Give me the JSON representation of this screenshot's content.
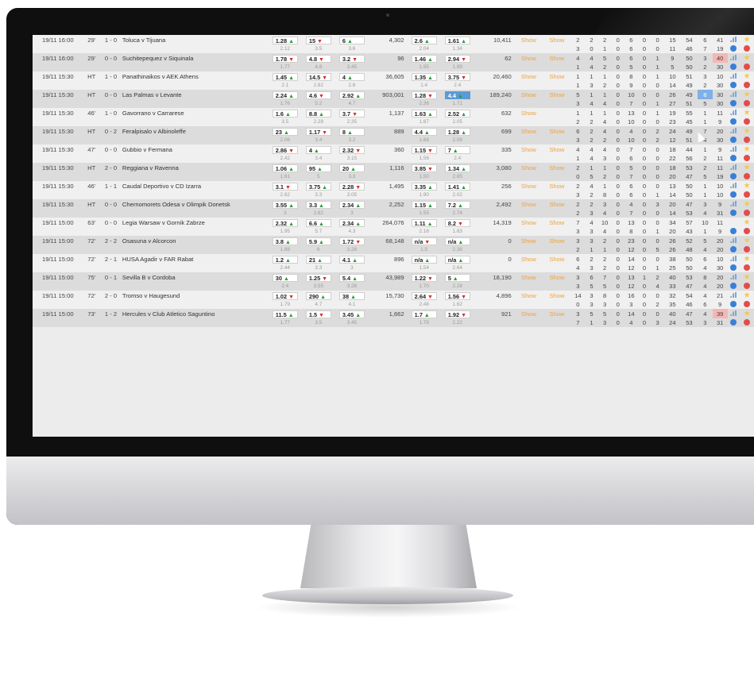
{
  "show_label": "Show",
  "rows": [
    {
      "time": "19/11 16:00",
      "minute": "29'",
      "score": "1 - 0",
      "match": "Toluca v Tijuana",
      "o1": "1.28",
      "d1": "up",
      "o2": "15",
      "d2": "down",
      "o3": "6",
      "d3": "up",
      "s1": "2.12",
      "s2": "3.5",
      "s3": "3.6",
      "vol": "4,302",
      "g1": "2.6",
      "gd1": "up",
      "g2": "1.61",
      "gd2": "up",
      "gs1": "2.04",
      "gs2": "1.34",
      "tvol": "10,411",
      "show1": "Show",
      "show2": "Show",
      "statsA": [
        "2",
        "2",
        "2",
        "0",
        "6",
        "0",
        "0",
        "15",
        "54",
        "6",
        "41"
      ],
      "statsB": [
        "3",
        "0",
        "1",
        "0",
        "6",
        "0",
        "0",
        "11",
        "46",
        "7",
        "19"
      ],
      "hlA": -1,
      "hlB": -1,
      "redA": -1,
      "redB": -1,
      "iconsA": [
        "chart",
        "star"
      ],
      "iconsB": [
        "info",
        "close"
      ]
    },
    {
      "time": "19/11 16:00",
      "minute": "29'",
      "score": "0 - 0",
      "match": "Suchitepequez v Siquinala",
      "o1": "1.78",
      "d1": "down",
      "o2": "4.8",
      "d2": "down",
      "o3": "3.2",
      "d3": "down",
      "s1": "1.77",
      "s2": "4.8",
      "s3": "3.45",
      "vol": "96",
      "g1": "1.46",
      "gd1": "up",
      "g2": "2.94",
      "gd2": "down",
      "gs1": "1.95",
      "gs2": "1.99",
      "tvol": "62",
      "show1": "Show",
      "show2": "Show",
      "statsA": [
        "4",
        "4",
        "5",
        "0",
        "6",
        "0",
        "1",
        "9",
        "50",
        "3",
        "40"
      ],
      "statsB": [
        "1",
        "4",
        "2",
        "0",
        "5",
        "0",
        "1",
        "5",
        "50",
        "2",
        "30"
      ],
      "hlA": -1,
      "hlB": -1,
      "redA": 10,
      "redB": -1,
      "iconsA": [
        "chart",
        "star"
      ],
      "iconsB": [
        "info",
        "close"
      ]
    },
    {
      "time": "19/11 15:30",
      "minute": "HT",
      "score": "1 - 0",
      "match": "Panathinaikos v AEK Athens",
      "o1": "1.45",
      "d1": "up",
      "o2": "14.5",
      "d2": "down",
      "o3": "4",
      "d3": "up",
      "s1": "2.1",
      "s2": "2.82",
      "s3": "2.8",
      "vol": "36,605",
      "g1": "1.35",
      "gd1": "up",
      "g2": "3.75",
      "gd2": "down",
      "gs1": "1.4",
      "gs2": "2.4",
      "tvol": "20,460",
      "show1": "Show",
      "show2": "Show",
      "statsA": [
        "1",
        "1",
        "1",
        "0",
        "8",
        "0",
        "1",
        "10",
        "51",
        "3",
        "10"
      ],
      "statsB": [
        "1",
        "3",
        "2",
        "0",
        "9",
        "0",
        "0",
        "14",
        "49",
        "2",
        "30"
      ],
      "hlA": -1,
      "hlB": -1,
      "redA": -1,
      "redB": -1,
      "iconsA": [
        "chart",
        "star"
      ],
      "iconsB": [
        "info",
        "close"
      ]
    },
    {
      "time": "19/11 15:30",
      "minute": "HT",
      "score": "0 - 0",
      "match": "Las Palmas v Levante",
      "o1": "2.24",
      "d1": "up",
      "o2": "4.6",
      "d2": "down",
      "o3": "2.92",
      "d3": "up",
      "s1": "1.76",
      "s2": "5.2",
      "s3": "4.7",
      "vol": "903,001",
      "g1": "1.28",
      "gd1": "down",
      "g2": "4.4",
      "gd2": "up",
      "gs1": "2.36",
      "gs2": "1.71",
      "tvol": "189,240",
      "show1": "Show",
      "show2": "Show",
      "statsA": [
        "5",
        "1",
        "1",
        "0",
        "10",
        "0",
        "0",
        "26",
        "49",
        "8",
        "30"
      ],
      "statsB": [
        "3",
        "4",
        "4",
        "0",
        "7",
        "0",
        "1",
        "27",
        "51",
        "5",
        "30"
      ],
      "hlA": 9,
      "hlB": -1,
      "redA": -1,
      "redB": -1,
      "g2hl": true,
      "iconsA": [
        "chart",
        "star"
      ],
      "iconsB": [
        "info",
        "close"
      ]
    },
    {
      "time": "19/11 15:30",
      "minute": "46'",
      "score": "1 - 0",
      "match": "Gavorrano v Carrarese",
      "o1": "1.6",
      "d1": "up",
      "o2": "8.8",
      "d2": "up",
      "o3": "3.7",
      "d3": "down",
      "s1": "3.5",
      "s2": "2.28",
      "s3": "2.35",
      "vol": "1,137",
      "g1": "1.63",
      "gd1": "up",
      "g2": "2.52",
      "gd2": "up",
      "gs1": "1.87",
      "gs2": "2.05",
      "tvol": "632",
      "show1": "Show",
      "show2": "",
      "statsA": [
        "1",
        "1",
        "1",
        "0",
        "13",
        "0",
        "1",
        "19",
        "55",
        "1",
        "11"
      ],
      "statsB": [
        "2",
        "2",
        "4",
        "0",
        "10",
        "0",
        "0",
        "23",
        "45",
        "1",
        "9"
      ],
      "hlA": -1,
      "hlB": -1,
      "redA": -1,
      "redB": -1,
      "iconsA": [
        "chart",
        "star"
      ],
      "iconsB": [
        "info",
        "close"
      ]
    },
    {
      "time": "19/11 15:30",
      "minute": "HT",
      "score": "0 - 2",
      "match": "Feralpisalo v Albinoleffe",
      "o1": "23",
      "d1": "up",
      "o2": "1.17",
      "d2": "down",
      "o3": "8",
      "d3": "up",
      "s1": "2.06",
      "s2": "3.4",
      "s3": "3.2",
      "vol": "889",
      "g1": "4.4",
      "gd1": "up",
      "g2": "1.28",
      "gd2": "up",
      "gs1": "1.68",
      "gs2": "2.08",
      "tvol": "699",
      "show1": "Show",
      "show2": "Show",
      "statsA": [
        "6",
        "2",
        "4",
        "0",
        "4",
        "0",
        "2",
        "24",
        "49",
        "7",
        "20"
      ],
      "statsB": [
        "3",
        "2",
        "2",
        "0",
        "10",
        "0",
        "2",
        "12",
        "51",
        "4",
        "30"
      ],
      "hlA": -1,
      "hlB": -1,
      "redA": -1,
      "redB": -1,
      "iconsA": [
        "chart",
        "star"
      ],
      "iconsB": [
        "info",
        "close"
      ]
    },
    {
      "time": "19/11 15:30",
      "minute": "47'",
      "score": "0 - 0",
      "match": "Gubbio v Fermana",
      "o1": "2.86",
      "d1": "down",
      "o2": "4",
      "d2": "up",
      "o3": "2.32",
      "d3": "down",
      "s1": "2.42",
      "s2": "3.4",
      "s3": "3.15",
      "vol": "360",
      "g1": "1.15",
      "gd1": "down",
      "g2": "7",
      "gd2": "up",
      "gs1": "1.56",
      "gs2": "2.4",
      "tvol": "335",
      "show1": "Show",
      "show2": "Show",
      "statsA": [
        "4",
        "4",
        "4",
        "0",
        "7",
        "0",
        "0",
        "18",
        "44",
        "1",
        "9"
      ],
      "statsB": [
        "1",
        "4",
        "3",
        "0",
        "6",
        "0",
        "0",
        "22",
        "56",
        "2",
        "11"
      ],
      "hlA": -1,
      "hlB": -1,
      "redA": -1,
      "redB": -1,
      "iconsA": [
        "chart",
        "star"
      ],
      "iconsB": [
        "info",
        "close"
      ]
    },
    {
      "time": "19/11 15:30",
      "minute": "HT",
      "score": "2 - 0",
      "match": "Reggiana v Ravenna",
      "o1": "1.06",
      "d1": "up",
      "o2": "95",
      "d2": "up",
      "o3": "20",
      "d3": "up",
      "s1": "1.61",
      "s2": "5",
      "s3": "3.3",
      "vol": "1,116",
      "g1": "3.85",
      "gd1": "down",
      "g2": "1.34",
      "gd2": "up",
      "gs1": "1.50",
      "gs2": "2.85",
      "tvol": "3,080",
      "show1": "Show",
      "show2": "Show",
      "statsA": [
        "2",
        "1",
        "1",
        "0",
        "5",
        "0",
        "0",
        "18",
        "53",
        "2",
        "11"
      ],
      "statsB": [
        "0",
        "5",
        "2",
        "0",
        "7",
        "0",
        "0",
        "20",
        "47",
        "5",
        "19"
      ],
      "hlA": -1,
      "hlB": -1,
      "redA": -1,
      "redB": -1,
      "iconsA": [
        "chart",
        "star"
      ],
      "iconsB": [
        "info",
        "close"
      ]
    },
    {
      "time": "19/11 15:30",
      "minute": "46'",
      "score": "1 - 1",
      "match": "Caudal Deportivo v CD Izarra",
      "o1": "3.1",
      "d1": "down",
      "o2": "3.75",
      "d2": "up",
      "o3": "2.28",
      "d3": "down",
      "s1": "2.62",
      "s2": "3.3",
      "s3": "3.05",
      "vol": "1,495",
      "g1": "3.35",
      "gd1": "up",
      "g2": "1.41",
      "gd2": "up",
      "gs1": "1.90",
      "gs2": "2.02",
      "tvol": "256",
      "show1": "Show",
      "show2": "Show",
      "statsA": [
        "2",
        "4",
        "1",
        "0",
        "6",
        "0",
        "0",
        "13",
        "50",
        "1",
        "10"
      ],
      "statsB": [
        "3",
        "2",
        "8",
        "0",
        "6",
        "0",
        "1",
        "14",
        "50",
        "1",
        "10"
      ],
      "hlA": -1,
      "hlB": -1,
      "redA": -1,
      "redB": -1,
      "iconsA": [
        "chart",
        "star"
      ],
      "iconsB": [
        "info",
        "close"
      ]
    },
    {
      "time": "19/11 15:30",
      "minute": "HT",
      "score": "0 - 0",
      "match": "Chernomorets Odesa v Olimpik Donetsk",
      "o1": "3.55",
      "d1": "up",
      "o2": "3.3",
      "d2": "up",
      "o3": "2.34",
      "d3": "up",
      "s1": "3",
      "s2": "2.82",
      "s3": "3",
      "vol": "2,252",
      "g1": "1.15",
      "gd1": "up",
      "g2": "7.2",
      "gd2": "up",
      "gs1": "1.55",
      "gs2": "2.74",
      "tvol": "2,492",
      "show1": "Show",
      "show2": "Show",
      "statsA": [
        "2",
        "2",
        "3",
        "0",
        "4",
        "0",
        "3",
        "20",
        "47",
        "3",
        "9"
      ],
      "statsB": [
        "2",
        "3",
        "4",
        "0",
        "7",
        "0",
        "0",
        "14",
        "53",
        "4",
        "31"
      ],
      "hlA": -1,
      "hlB": -1,
      "redA": -1,
      "redB": -1,
      "iconsA": [
        "chart",
        "star"
      ],
      "iconsB": [
        "info",
        "close"
      ]
    },
    {
      "time": "19/11 15:00",
      "minute": "63'",
      "score": "0 - 0",
      "match": "Legia Warsaw v Gornik Zabrze",
      "o1": "2.32",
      "d1": "up",
      "o2": "6.6",
      "d2": "up",
      "o3": "2.34",
      "d3": "up",
      "s1": "1.95",
      "s2": "5.7",
      "s3": "4.3",
      "vol": "264,076",
      "g1": "1.11",
      "gd1": "up",
      "g2": "8.2",
      "gd2": "down",
      "gs1": "2.16",
      "gs2": "1.83",
      "tvol": "14,319",
      "show1": "Show",
      "show2": "Show",
      "statsA": [
        "7",
        "4",
        "10",
        "0",
        "13",
        "0",
        "0",
        "34",
        "57",
        "10",
        "11"
      ],
      "statsB": [
        "3",
        "3",
        "4",
        "0",
        "8",
        "0",
        "1",
        "20",
        "43",
        "1",
        "9"
      ],
      "hlA": -1,
      "hlB": -1,
      "redA": -1,
      "redB": -1,
      "iconsA": [
        "star"
      ],
      "iconsB": [
        "info",
        "close"
      ]
    },
    {
      "time": "19/11 15:00",
      "minute": "72'",
      "score": "2 - 2",
      "match": "Osasuna v Alcorcon",
      "o1": "3.8",
      "d1": "up",
      "o2": "5.9",
      "d2": "up",
      "o3": "1.72",
      "d3": "down",
      "s1": "1.88",
      "s2": "6",
      "s3": "3.28",
      "vol": "68,148",
      "g1": "n/a",
      "gd1": "down",
      "g2": "n/a",
      "gd2": "up",
      "gs1": "1.5",
      "gs2": "2.38",
      "tvol": "0",
      "show1": "Show",
      "show2": "Show",
      "statsA": [
        "3",
        "3",
        "2",
        "0",
        "23",
        "0",
        "0",
        "26",
        "52",
        "5",
        "20"
      ],
      "statsB": [
        "2",
        "1",
        "1",
        "0",
        "12",
        "0",
        "5",
        "26",
        "48",
        "4",
        "20"
      ],
      "hlA": -1,
      "hlB": -1,
      "redA": -1,
      "redB": -1,
      "iconsA": [
        "chart",
        "star"
      ],
      "iconsB": [
        "info",
        "close"
      ]
    },
    {
      "time": "19/11 15:00",
      "minute": "72'",
      "score": "2 - 1",
      "match": "HUSA Agadir v FAR Rabat",
      "o1": "1.2",
      "d1": "up",
      "o2": "21",
      "d2": "up",
      "o3": "4.1",
      "d3": "up",
      "s1": "2.44",
      "s2": "3.3",
      "s3": "3",
      "vol": "896",
      "g1": "n/a",
      "gd1": "up",
      "g2": "n/a",
      "gd2": "up",
      "gs1": "1.54",
      "gs2": "2.64",
      "tvol": "0",
      "show1": "Show",
      "show2": "Show",
      "statsA": [
        "6",
        "2",
        "2",
        "0",
        "14",
        "0",
        "0",
        "38",
        "50",
        "6",
        "10"
      ],
      "statsB": [
        "4",
        "3",
        "2",
        "0",
        "12",
        "0",
        "1",
        "25",
        "50",
        "4",
        "30"
      ],
      "hlA": -1,
      "hlB": -1,
      "redA": -1,
      "redB": -1,
      "iconsA": [
        "chart",
        "star"
      ],
      "iconsB": [
        "info",
        "close"
      ]
    },
    {
      "time": "19/11 15:00",
      "minute": "75'",
      "score": "0 - 1",
      "match": "Sevilla B v Cordoba",
      "o1": "30",
      "d1": "up",
      "o2": "1.25",
      "d2": "down",
      "o3": "5.4",
      "d3": "up",
      "s1": "2.4",
      "s2": "3.55",
      "s3": "3.28",
      "vol": "43,989",
      "g1": "1.22",
      "gd1": "down",
      "g2": "5",
      "gd2": "up",
      "gs1": "1.70",
      "gs2": "2.28",
      "tvol": "18,190",
      "show1": "Show",
      "show2": "Show",
      "statsA": [
        "3",
        "6",
        "7",
        "0",
        "13",
        "1",
        "2",
        "40",
        "53",
        "8",
        "20"
      ],
      "statsB": [
        "3",
        "5",
        "5",
        "0",
        "12",
        "0",
        "4",
        "33",
        "47",
        "4",
        "20"
      ],
      "hlA": -1,
      "hlB": -1,
      "redA": -1,
      "redB": -1,
      "iconsA": [
        "chart",
        "star"
      ],
      "iconsB": [
        "info",
        "close"
      ]
    },
    {
      "time": "19/11 15:00",
      "minute": "72'",
      "score": "2 - 0",
      "match": "Tromso v Haugesund",
      "o1": "1.02",
      "d1": "down",
      "o2": "290",
      "d2": "up",
      "o3": "38",
      "d3": "up",
      "s1": "1.79",
      "s2": "4.7",
      "s3": "4.1",
      "vol": "15,730",
      "g1": "2.64",
      "gd1": "down",
      "g2": "1.56",
      "gd2": "down",
      "gs1": "2.48",
      "gs2": "1.62",
      "tvol": "4,896",
      "show1": "Show",
      "show2": "Show",
      "statsA": [
        "14",
        "3",
        "8",
        "0",
        "16",
        "0",
        "0",
        "32",
        "54",
        "4",
        "21"
      ],
      "statsB": [
        "0",
        "3",
        "3",
        "0",
        "3",
        "0",
        "2",
        "35",
        "46",
        "6",
        "9"
      ],
      "hlA": -1,
      "hlB": -1,
      "redA": -1,
      "redB": -1,
      "iconsA": [
        "chart",
        "star"
      ],
      "iconsB": [
        "info",
        "close"
      ]
    },
    {
      "time": "19/11 15:00",
      "minute": "73'",
      "score": "1 - 2",
      "match": "Hercules v Club Atletico Saguntino",
      "o1": "11.5",
      "d1": "up",
      "o2": "1.5",
      "d2": "down",
      "o3": "3.45",
      "d3": "up",
      "s1": "1.77",
      "s2": "3.5",
      "s3": "3.45",
      "vol": "1,662",
      "g1": "1.7",
      "gd1": "up",
      "g2": "1.92",
      "gd2": "down",
      "gs1": "1.78",
      "gs2": "2.22",
      "tvol": "921",
      "show1": "Show",
      "show2": "Show",
      "statsA": [
        "3",
        "5",
        "5",
        "0",
        "14",
        "0",
        "0",
        "40",
        "47",
        "4",
        "39"
      ],
      "statsB": [
        "7",
        "1",
        "3",
        "0",
        "4",
        "0",
        "3",
        "24",
        "53",
        "3",
        "31"
      ],
      "hlA": -1,
      "hlB": -1,
      "redA": 10,
      "redB": -1,
      "iconsA": [
        "chart",
        "star"
      ],
      "iconsB": [
        "info",
        "close"
      ]
    }
  ]
}
